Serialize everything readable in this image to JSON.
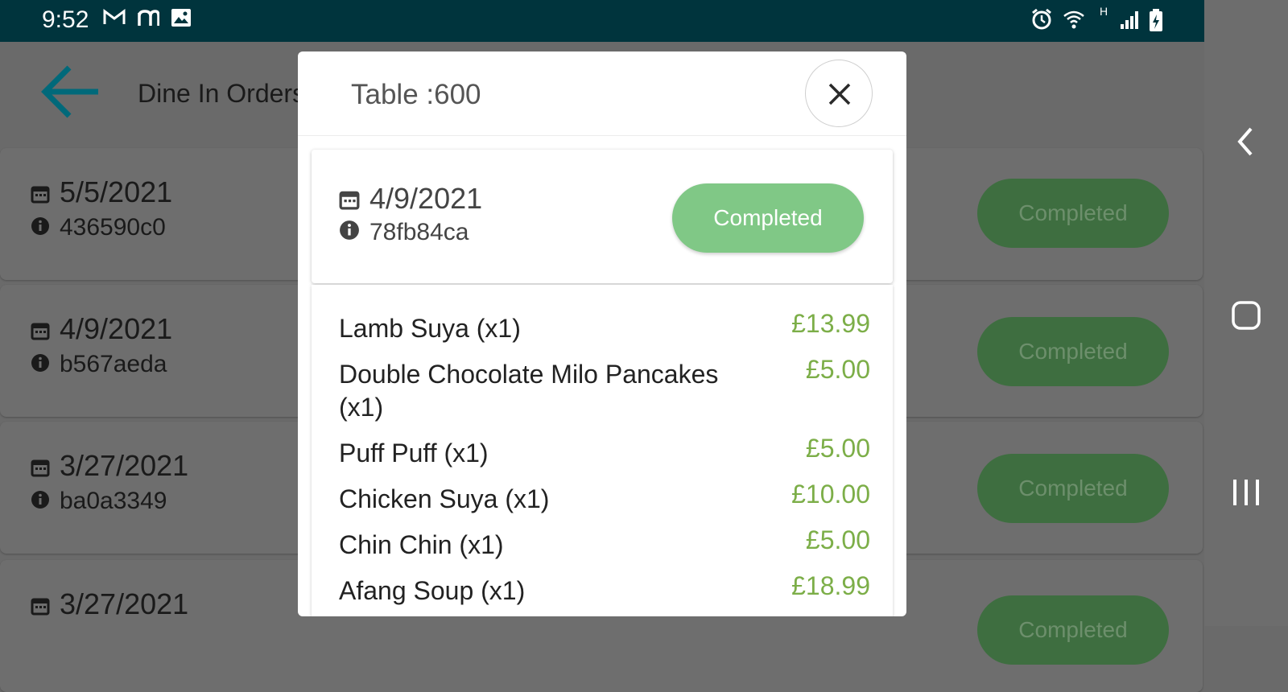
{
  "status_bar": {
    "time": "9:52",
    "icons": [
      "gmail-icon",
      "notification-icon",
      "image-icon",
      "alarm-icon",
      "wifi-icon",
      "signal-icon",
      "battery-icon"
    ],
    "network_label": "H"
  },
  "header": {
    "title": "Dine In Orders",
    "icons": [
      "back-arrow-icon"
    ]
  },
  "background_orders": [
    {
      "date": "5/5/2021",
      "id": "436590c0",
      "status": "Completed"
    },
    {
      "date": "4/9/2021",
      "id": "b567aeda",
      "status": "Completed"
    },
    {
      "date": "3/27/2021",
      "id": "ba0a3349",
      "status": "Completed"
    },
    {
      "date": "3/27/2021",
      "id": "",
      "status": "Completed"
    }
  ],
  "modal": {
    "title": "Table :600",
    "close_icon": "close-icon",
    "order": {
      "date": "4/9/2021",
      "id": "78fb84ca",
      "status": "Completed",
      "status_color": "#80c886"
    },
    "items": [
      {
        "name": "Lamb Suya (x1)",
        "price": "£13.99"
      },
      {
        "name": "Double Chocolate Milo Pancakes (x1)",
        "price": "£5.00"
      },
      {
        "name": "Puff Puff (x1)",
        "price": "£5.00"
      },
      {
        "name": "Chicken Suya (x1)",
        "price": "£10.00"
      },
      {
        "name": "Chin Chin (x1)",
        "price": "£5.00"
      },
      {
        "name": "Afang Soup (x1)",
        "price": "£18.99"
      }
    ],
    "price_color": "#7cae48"
  },
  "colors": {
    "status_bar": "#00343d",
    "accent": "#00697a",
    "overlay": "#6a6a6a"
  }
}
